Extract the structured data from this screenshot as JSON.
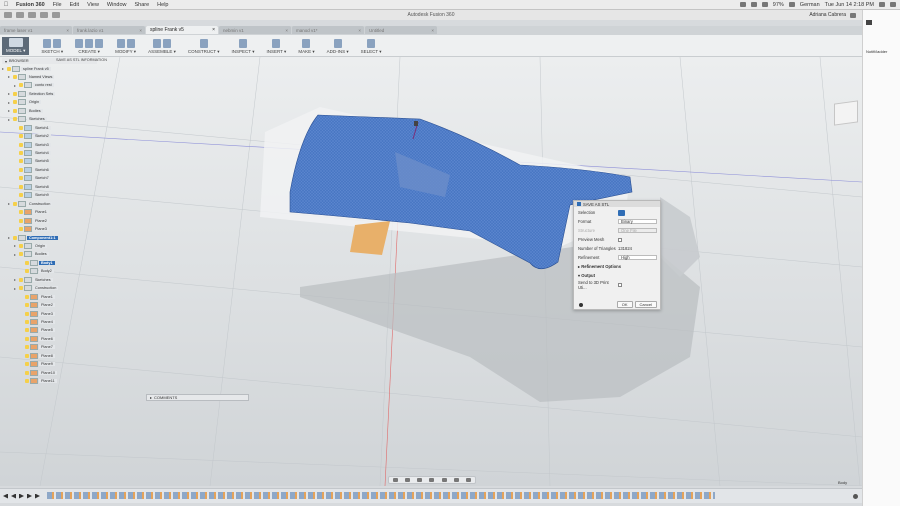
{
  "menubar": {
    "app": "Fusion 360",
    "items": [
      "File",
      "Edit",
      "View",
      "Window",
      "Share",
      "Help"
    ],
    "battery": "97%",
    "language": "German",
    "clock": "Tue Jun 14  2:18 PM"
  },
  "window": {
    "title": "Autodesk Fusion 360",
    "user": "Adriana Cabrera"
  },
  "tabs": [
    {
      "label": "frame laser v1",
      "active": false
    },
    {
      "label": "frank.lazio v1",
      "active": false
    },
    {
      "label": "spline Frank v5",
      "active": true
    },
    {
      "label": "nebmin v1",
      "active": false
    },
    {
      "label": "manod v1*",
      "active": false
    },
    {
      "label": "Untitled",
      "active": false
    }
  ],
  "toolbar": [
    {
      "label": "MODEL ▾",
      "icons": 1,
      "primary": true
    },
    {
      "label": "SKETCH ▾",
      "icons": 2
    },
    {
      "label": "CREATE ▾",
      "icons": 3
    },
    {
      "label": "MODIFY ▾",
      "icons": 2
    },
    {
      "label": "ASSEMBLE ▾",
      "icons": 2
    },
    {
      "label": "CONSTRUCT ▾",
      "icons": 1
    },
    {
      "label": "INSPECT ▾",
      "icons": 1
    },
    {
      "label": "INSERT ▾",
      "icons": 1
    },
    {
      "label": "MAKE ▾",
      "icons": 1
    },
    {
      "label": "ADD-INS ▾",
      "icons": 1
    },
    {
      "label": "SELECT ▾",
      "icons": 1
    }
  ],
  "breadcrumb": "SAVE AS STL INFORMATION",
  "browser": {
    "title": "BROWSER",
    "rows": [
      {
        "d": 0,
        "t": "spline Frank v5",
        "b": "doc"
      },
      {
        "d": 1,
        "t": "Named Views",
        "b": "folder"
      },
      {
        "d": 2,
        "t": "conto rest",
        "b": "folder"
      },
      {
        "d": 1,
        "t": "Selection Sets",
        "b": "folder"
      },
      {
        "d": 1,
        "t": "Origin",
        "b": "folder"
      },
      {
        "d": 1,
        "t": "Bodies",
        "b": "folder"
      },
      {
        "d": 1,
        "t": "Sketches",
        "b": "folder"
      },
      {
        "d": 2,
        "t": "Sketch1",
        "b": "sk"
      },
      {
        "d": 2,
        "t": "Sketch2",
        "b": "sk"
      },
      {
        "d": 2,
        "t": "Sketch3",
        "b": "sk"
      },
      {
        "d": 2,
        "t": "Sketch4",
        "b": "sk"
      },
      {
        "d": 2,
        "t": "Sketch5",
        "b": "sk"
      },
      {
        "d": 2,
        "t": "Sketch6",
        "b": "sk"
      },
      {
        "d": 2,
        "t": "Sketch7",
        "b": "sk"
      },
      {
        "d": 2,
        "t": "Sketch8",
        "b": "sk"
      },
      {
        "d": 2,
        "t": "Sketch9",
        "b": "sk"
      },
      {
        "d": 1,
        "t": "Construction",
        "b": "folder"
      },
      {
        "d": 2,
        "t": "Plane1",
        "b": "pl"
      },
      {
        "d": 2,
        "t": "Plane2",
        "b": "pl"
      },
      {
        "d": 2,
        "t": "Plane3",
        "b": "pl"
      },
      {
        "d": 1,
        "t": "Component1:1",
        "b": "comp",
        "hl": true
      },
      {
        "d": 2,
        "t": "Origin",
        "b": "folder"
      },
      {
        "d": 2,
        "t": "Bodies",
        "b": "folder"
      },
      {
        "d": 3,
        "t": "Body1",
        "b": "body",
        "hl": true
      },
      {
        "d": 3,
        "t": "Body2",
        "b": "body"
      },
      {
        "d": 2,
        "t": "Sketches",
        "b": "folder"
      },
      {
        "d": 2,
        "t": "Construction",
        "b": "folder"
      },
      {
        "d": 3,
        "t": "Plane1",
        "b": "pl"
      },
      {
        "d": 3,
        "t": "Plane2",
        "b": "pl"
      },
      {
        "d": 3,
        "t": "Plane3",
        "b": "pl"
      },
      {
        "d": 3,
        "t": "Plane4",
        "b": "pl"
      },
      {
        "d": 3,
        "t": "Plane5",
        "b": "pl"
      },
      {
        "d": 3,
        "t": "Plane6",
        "b": "pl"
      },
      {
        "d": 3,
        "t": "Plane7",
        "b": "pl"
      },
      {
        "d": 3,
        "t": "Plane8",
        "b": "pl"
      },
      {
        "d": 3,
        "t": "Plane9",
        "b": "pl"
      },
      {
        "d": 3,
        "t": "Plane10",
        "b": "pl"
      },
      {
        "d": 3,
        "t": "Plane11",
        "b": "pl"
      }
    ]
  },
  "dialog": {
    "title": "SAVE AS STL",
    "selection_label": "Selection",
    "format_label": "Format",
    "format_value": "Binary",
    "structure_label": "Structure",
    "structure_value": "One File",
    "preview_label": "Preview Mesh",
    "triangles_label": "Number of Triangles",
    "triangles_value": "131824",
    "refinement_label": "Refinement",
    "refinement_value": "High",
    "refinement_options": "▸ Refinement Options",
    "output_label": "▾ Output",
    "send_label": "Send to 3D Print Uti...",
    "ok": "OK",
    "cancel": "Cancel"
  },
  "comments": "COMMENTS",
  "status_label": "Body",
  "side_panel_text": "Notifi/ladder",
  "colors": {
    "mesh": "#4a78c4",
    "accent": "#2f6db5",
    "construction": "#e8b06a"
  }
}
